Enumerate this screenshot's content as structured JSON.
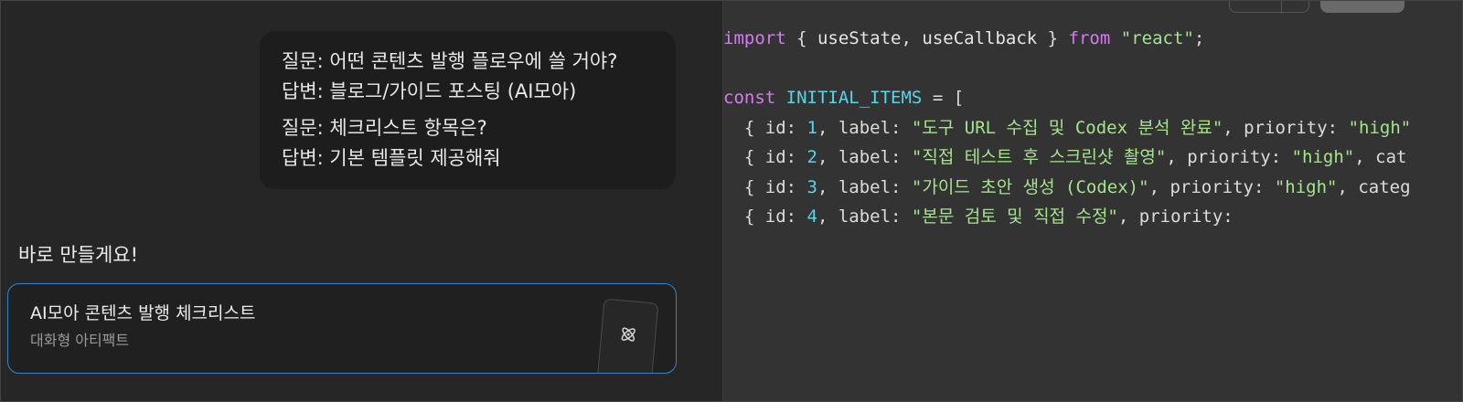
{
  "chat": {
    "user_message": {
      "qa": [
        {
          "q": "질문: 어떤 콘텐츠 발행 플로우에 쓸 거야?",
          "a": "답변: 블로그/가이드 포스팅 (AI모아)"
        },
        {
          "q": "질문: 체크리스트 항목은?",
          "a": "답변: 기본 템플릿 제공해줘"
        }
      ]
    },
    "assistant_reply": "바로 만들게요!",
    "artifact": {
      "title": "AI모아 콘텐츠 발행 체크리스트",
      "subtitle": "대화형 아티팩트",
      "icon": "atom-icon"
    }
  },
  "code": {
    "lines": [
      [
        {
          "t": "import",
          "c": "kw"
        },
        {
          "t": " { ",
          "c": "plain"
        },
        {
          "t": "useState",
          "c": "fn"
        },
        {
          "t": ", ",
          "c": "plain"
        },
        {
          "t": "useCallback",
          "c": "fn"
        },
        {
          "t": " } ",
          "c": "plain"
        },
        {
          "t": "from",
          "c": "kw"
        },
        {
          "t": " ",
          "c": "plain"
        },
        {
          "t": "\"react\"",
          "c": "str"
        },
        {
          "t": ";",
          "c": "plain"
        }
      ],
      [],
      [
        {
          "t": "const",
          "c": "kw"
        },
        {
          "t": " ",
          "c": "plain"
        },
        {
          "t": "INITIAL_ITEMS",
          "c": "const"
        },
        {
          "t": " = [",
          "c": "plain"
        }
      ],
      [
        {
          "t": "  { id: ",
          "c": "plain"
        },
        {
          "t": "1",
          "c": "num"
        },
        {
          "t": ", label: ",
          "c": "plain"
        },
        {
          "t": "\"도구 URL 수집 및 Codex 분석 완료\"",
          "c": "str"
        },
        {
          "t": ", priority: ",
          "c": "plain"
        },
        {
          "t": "\"high\"",
          "c": "str"
        }
      ],
      [
        {
          "t": "  { id: ",
          "c": "plain"
        },
        {
          "t": "2",
          "c": "num"
        },
        {
          "t": ", label: ",
          "c": "plain"
        },
        {
          "t": "\"직접 테스트 후 스크린샷 촬영\"",
          "c": "str"
        },
        {
          "t": ", priority: ",
          "c": "plain"
        },
        {
          "t": "\"high\"",
          "c": "str"
        },
        {
          "t": ", cat",
          "c": "plain"
        }
      ],
      [
        {
          "t": "  { id: ",
          "c": "plain"
        },
        {
          "t": "3",
          "c": "num"
        },
        {
          "t": ", label: ",
          "c": "plain"
        },
        {
          "t": "\"가이드 초안 생성 (Codex)\"",
          "c": "str"
        },
        {
          "t": ", priority: ",
          "c": "plain"
        },
        {
          "t": "\"high\"",
          "c": "str"
        },
        {
          "t": ", categ",
          "c": "plain"
        }
      ],
      [
        {
          "t": "  { id: ",
          "c": "plain"
        },
        {
          "t": "4",
          "c": "num"
        },
        {
          "t": ", label: ",
          "c": "plain"
        },
        {
          "t": "\"본문 검토 및 직접 수정\"",
          "c": "str"
        },
        {
          "t": ", priority:",
          "c": "plain"
        }
      ]
    ],
    "colors": {
      "kw": "#d67bf0",
      "str": "#a5e38d",
      "const": "#56d6e8",
      "num": "#56d6e8",
      "plain": "#dcdcdc"
    }
  },
  "theme": {
    "chat_bg": "#262626",
    "code_bg": "#333333",
    "accent_border": "#3b82c4"
  }
}
